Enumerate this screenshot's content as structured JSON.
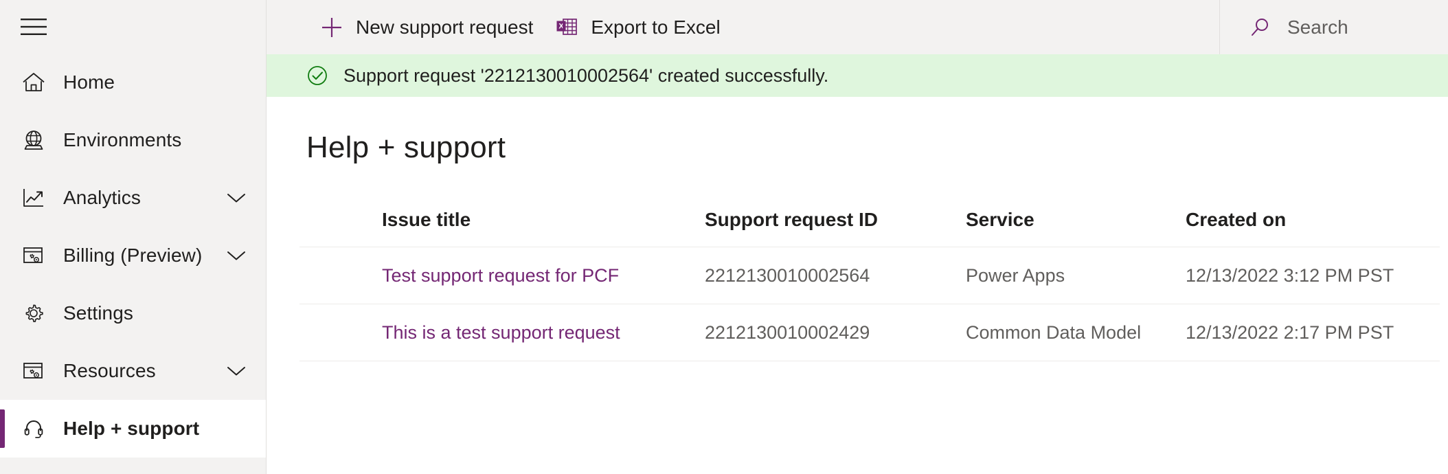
{
  "sidebar": {
    "menu_icon": "hamburger-icon",
    "items": [
      {
        "label": "Home",
        "icon": "home-icon",
        "expandable": false,
        "selected": false
      },
      {
        "label": "Environments",
        "icon": "globe-icon",
        "expandable": false,
        "selected": false
      },
      {
        "label": "Analytics",
        "icon": "chart-line-icon",
        "expandable": true,
        "selected": false
      },
      {
        "label": "Billing (Preview)",
        "icon": "billing-icon",
        "expandable": true,
        "selected": false
      },
      {
        "label": "Settings",
        "icon": "gear-icon",
        "expandable": false,
        "selected": false
      },
      {
        "label": "Resources",
        "icon": "resources-icon",
        "expandable": true,
        "selected": false
      },
      {
        "label": "Help + support",
        "icon": "headset-icon",
        "expandable": false,
        "selected": true
      }
    ]
  },
  "toolbar": {
    "new_request_label": "New support request",
    "new_request_icon": "plus-icon",
    "export_label": "Export to Excel",
    "export_icon": "excel-icon"
  },
  "search": {
    "placeholder": "Search",
    "value": "",
    "icon": "search-icon"
  },
  "banner": {
    "icon": "check-circle-icon",
    "message": "Support request '2212130010002564' created successfully."
  },
  "page": {
    "title": "Help + support"
  },
  "table": {
    "columns": [
      "Issue title",
      "Support request ID",
      "Service",
      "Created on"
    ],
    "rows": [
      {
        "issue_title": "Test support request for PCF",
        "request_id": "2212130010002564",
        "service": "Power Apps",
        "created_on": "12/13/2022 3:12 PM PST"
      },
      {
        "issue_title": "This is a test support request",
        "request_id": "2212130010002429",
        "service": "Common Data Model",
        "created_on": "12/13/2022 2:17 PM PST"
      }
    ]
  },
  "colors": {
    "accent_purple": "#742774",
    "sidebar_bg": "#f3f2f1",
    "banner_bg": "#dff6dd",
    "banner_icon": "#107c10",
    "text_primary": "#201f1e",
    "text_secondary": "#605e5c"
  }
}
